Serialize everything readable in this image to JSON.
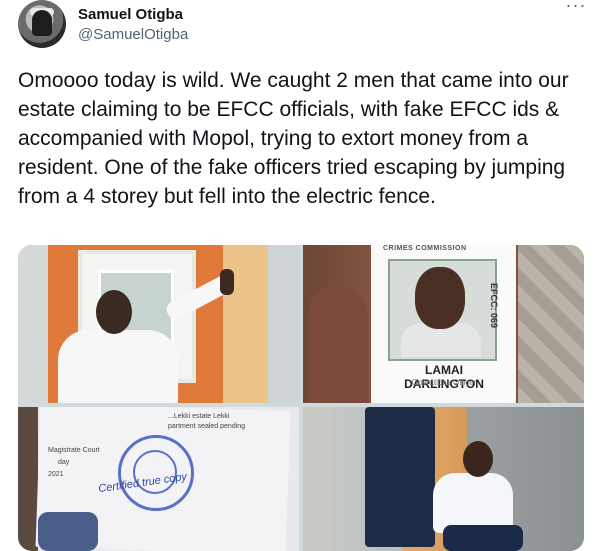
{
  "author": {
    "display_name": "Samuel Otigba",
    "handle": "@SamuelOtigba",
    "avatar_icon": "avatar-photo"
  },
  "menu": {
    "more_label": "···"
  },
  "tweet": {
    "text": "Omoooo today is wild. We caught 2 men that came into our estate claiming to be EFCC officials, with fake EFCC ids & accompanied with Mopol, trying to extort money from a resident. One of the fake officers tried escaping by jumping from a 4 storey but fell into the electric fence."
  },
  "media": {
    "id_card": {
      "header": "CRIMES COMMISSION",
      "number": "EFCC: 069",
      "name": "LAMAI DARLINGTON",
      "role": "Operations Officer"
    },
    "document": {
      "line1": "...Lekki estate Lekki",
      "line2": "partment sealed pending",
      "line3": "Magistrate Court",
      "line4": "day",
      "line5": "2021",
      "handwriting": "Certified true copy"
    }
  },
  "colors": {
    "text": "#0f1419",
    "secondary": "#536471",
    "background": "#ffffff"
  }
}
